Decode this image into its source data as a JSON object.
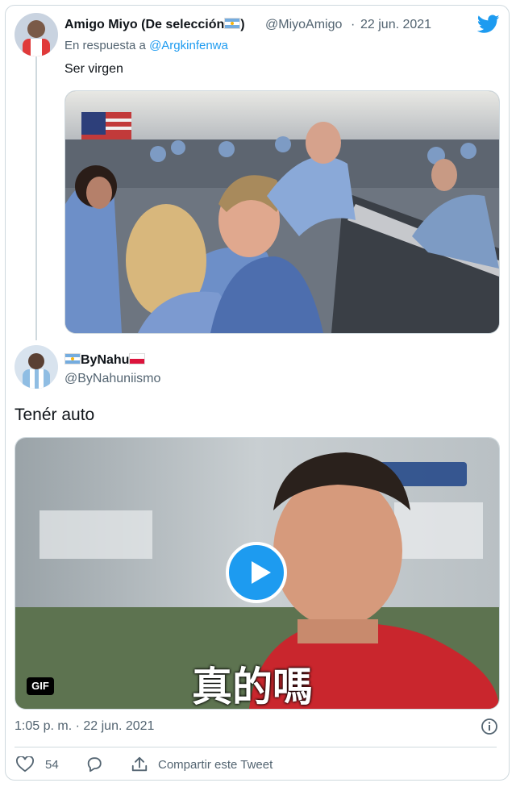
{
  "tweet1": {
    "display_name": "Amigo Miyo (De selección",
    "display_name_end": ")",
    "handle": "@MiyoAmigo",
    "sep": "·",
    "date": "22 jun. 2021",
    "reply_prefix": "En respuesta a",
    "reply_to": "@Argkinfenwa",
    "text": "Ser virgen"
  },
  "tweet2": {
    "display_name": "ByNahu",
    "handle": "@ByNahuniismo",
    "text": "Tenér auto",
    "media_badge": "GIF",
    "gif_caption": "真的嗎",
    "timestamp": "1:05 p. m. · 22 jun. 2021",
    "likes": "54",
    "share_label": "Compartir este Tweet"
  },
  "icons": [
    "twitter-bird-icon",
    "play-icon",
    "info-icon",
    "heart-icon",
    "reply-icon",
    "share-icon"
  ],
  "colors": {
    "accent": "#1d9bf0",
    "secondary_text": "#536471",
    "border": "#cfd9de"
  }
}
